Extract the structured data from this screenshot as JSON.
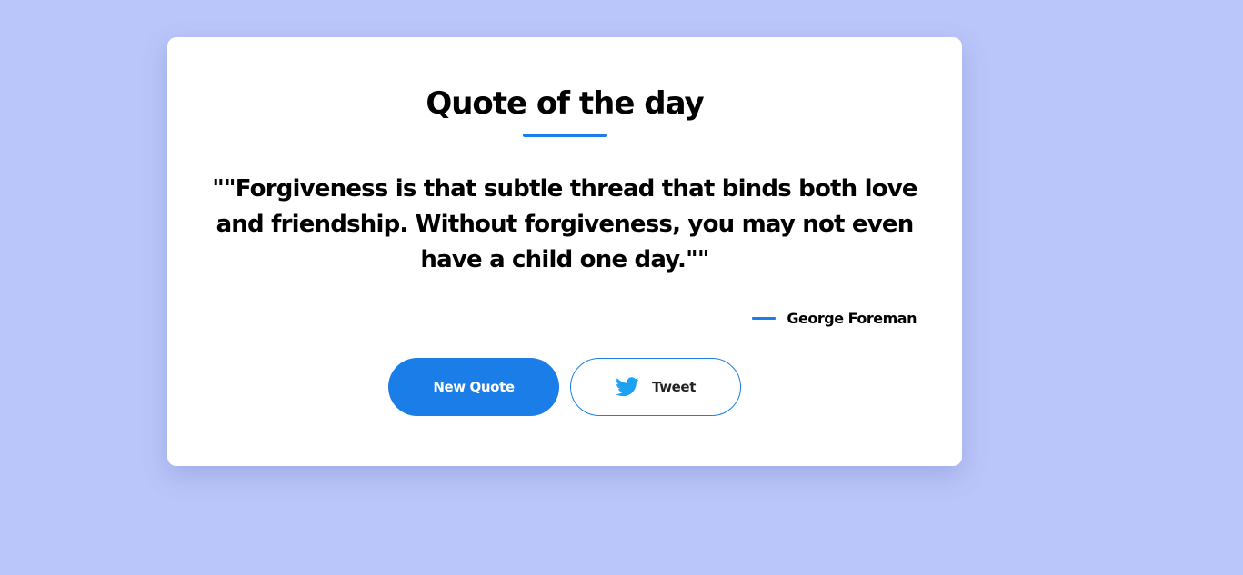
{
  "page": {
    "background_color": "#bac6f9"
  },
  "card": {
    "title": "Quote of the day",
    "quote": "\"\"Forgiveness is that subtle thread that binds both love and friendship. Without forgiveness, you may not even have a child one day.\"\"",
    "author": "George Foreman",
    "accent_color": "#1b7ee8"
  },
  "buttons": {
    "new_quote_label": "New Quote",
    "tweet_label": "Tweet",
    "tweet_icon": "twitter-bird-icon"
  }
}
